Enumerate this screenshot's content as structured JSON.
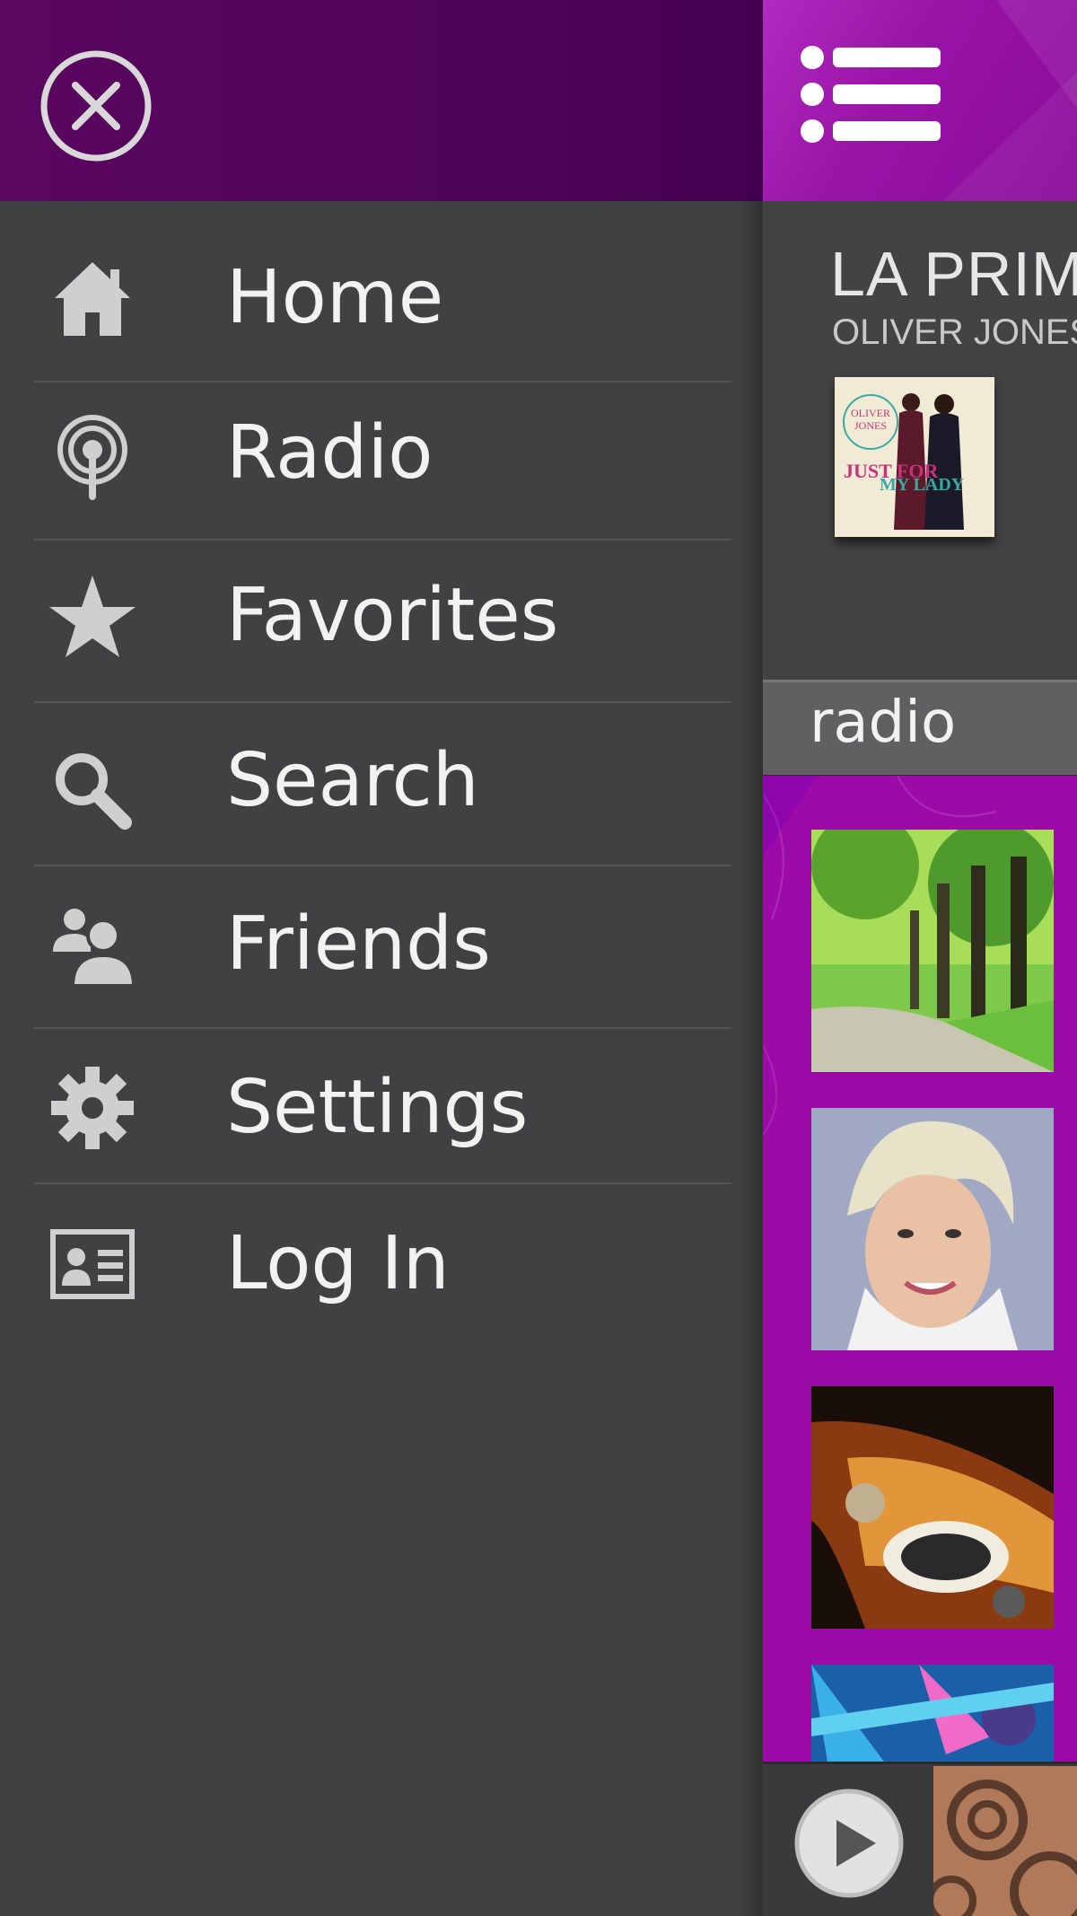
{
  "drawer": {
    "menu": [
      {
        "label": "Home",
        "icon": "home-icon"
      },
      {
        "label": "Radio",
        "icon": "radio-icon"
      },
      {
        "label": "Favorites",
        "icon": "star-icon"
      },
      {
        "label": "Search",
        "icon": "search-icon"
      },
      {
        "label": "Friends",
        "icon": "friends-icon"
      },
      {
        "label": "Settings",
        "icon": "gear-icon"
      },
      {
        "label": "Log In",
        "icon": "id-card-icon"
      }
    ],
    "close_icon": "close-icon"
  },
  "now_playing": {
    "title": "LA PRIM",
    "artist": "OLIVER JONES",
    "album_art_text": [
      "OLIVER",
      "JONES",
      "JUST FOR",
      "MY LADY"
    ]
  },
  "section": {
    "label": "radio"
  },
  "stations": [
    {
      "image": "forest-path-photo"
    },
    {
      "image": "blonde-woman-portrait"
    },
    {
      "image": "guitar-closeup-photo"
    },
    {
      "image": "blue-concert-lights-photo"
    }
  ],
  "colors": {
    "drawer_header": "#4e0358",
    "accent_purple": "#9c0aa8",
    "drawer_bg": "#414143",
    "text": "#f2f2f2"
  }
}
